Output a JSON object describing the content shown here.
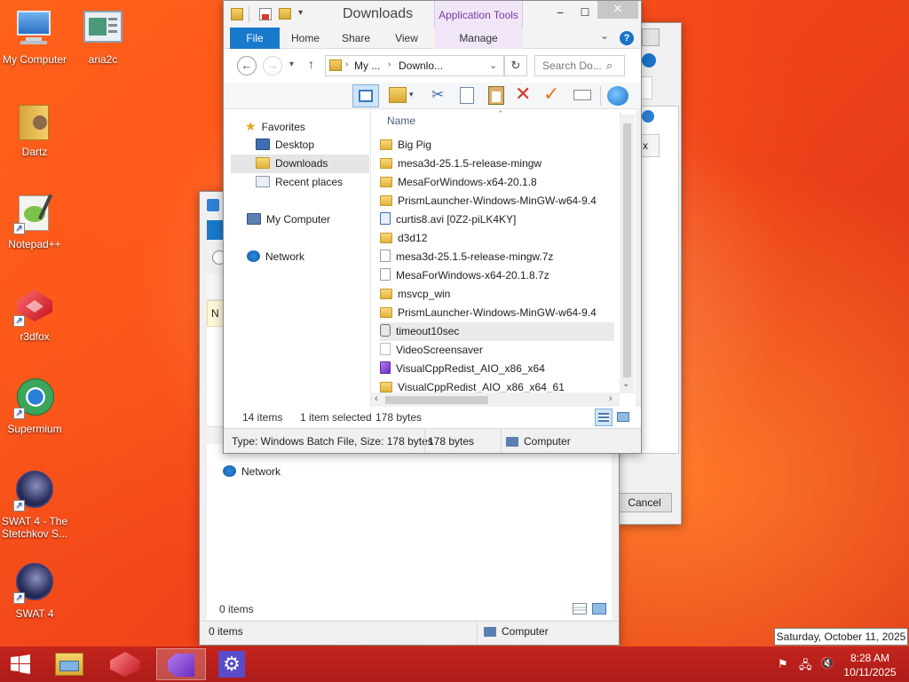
{
  "desktop": {
    "icons": [
      {
        "label": "My Computer"
      },
      {
        "label": "aria2c"
      },
      {
        "label": "Dartz"
      },
      {
        "label": "Notepad++"
      },
      {
        "label": "r3dfox"
      },
      {
        "label": "Supermium"
      },
      {
        "label": "SWAT 4 - The Stetchkov S..."
      },
      {
        "label": "SWAT 4"
      }
    ]
  },
  "bg_window": {
    "nav_fragment": "N",
    "network_label": "Network",
    "items_count": "0 items",
    "status_items": "0 items",
    "status_location": "Computer"
  },
  "dialog_window": {
    "cancel_label": "Cancel",
    "fragment": "x"
  },
  "explorer": {
    "title": "Downloads",
    "context_tab": "Application Tools",
    "ribbon_tabs": [
      "File",
      "Home",
      "Share",
      "View",
      "Manage"
    ],
    "breadcrumb": [
      "My ...",
      "Downlo..."
    ],
    "search_placeholder": "Search Do...",
    "nav": {
      "favorites": "Favorites",
      "desktop": "Desktop",
      "downloads": "Downloads",
      "recent": "Recent places",
      "computer": "My Computer",
      "network": "Network"
    },
    "column_name": "Name",
    "files": [
      {
        "name": "Big Pig",
        "kind": "folder"
      },
      {
        "name": "mesa3d-25.1.5-release-mingw",
        "kind": "folder"
      },
      {
        "name": "MesaForWindows-x64-20.1.8",
        "kind": "folder"
      },
      {
        "name": "PrismLauncher-Windows-MinGW-w64-9.4",
        "kind": "folder"
      },
      {
        "name": "curtis8.avi [0Z2-piLK4KY]",
        "kind": "video"
      },
      {
        "name": "d3d12",
        "kind": "folder"
      },
      {
        "name": "mesa3d-25.1.5-release-mingw.7z",
        "kind": "file"
      },
      {
        "name": "MesaForWindows-x64-20.1.8.7z",
        "kind": "file"
      },
      {
        "name": "msvcp_win",
        "kind": "folder"
      },
      {
        "name": "PrismLauncher-Windows-MinGW-w64-9.4",
        "kind": "folder"
      },
      {
        "name": "timeout10sec",
        "kind": "batch"
      },
      {
        "name": "VideoScreensaver",
        "kind": "app"
      },
      {
        "name": "VisualCppRedist_AIO_x86_x64",
        "kind": "installer"
      },
      {
        "name": "VisualCppRedist_AIO_x86_x64_61",
        "kind": "folder"
      }
    ],
    "status": {
      "count": "14 items",
      "selected": "1 item selected",
      "size": "178 bytes"
    },
    "info": {
      "type": "Type: Windows Batch File, Size: 178 bytes",
      "size": "178 bytes",
      "location": "Computer"
    }
  },
  "taskbar": {
    "tooltip": "Saturday, October 11, 2025",
    "time": "8:28 AM",
    "date": "10/11/2025"
  },
  "colors": {
    "accent": "#1979ca",
    "taskbar": "#b81f1a",
    "desktop": "#f2461a"
  }
}
